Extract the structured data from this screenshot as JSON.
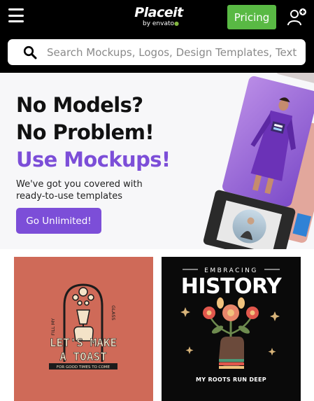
{
  "header": {
    "logo_main": "Placeit",
    "logo_sub": "by envato",
    "pricing_label": "Pricing",
    "icons": {
      "menu": "hamburger-menu-icon",
      "account": "user-add-icon"
    },
    "colors": {
      "background": "#000000",
      "pricing": "#59b944"
    }
  },
  "search": {
    "placeholder": "Search Mockups, Logos, Design Templates, Text",
    "value": "",
    "icon": "search-icon"
  },
  "hero": {
    "line1": "No Models?",
    "line2": "No Problem!",
    "line3": "Use Mockups!",
    "subtitle": "We've got you covered with ready-to-use templates",
    "cta_label": "Go Unlimited!",
    "colors": {
      "accent": "#7c4ed8",
      "background": "#f7f7f9"
    }
  },
  "products": [
    {
      "name": "lets-make-a-toast-design",
      "side_left": "FILL MY",
      "side_right": "GLASS",
      "line1": "LET'S MAKE",
      "line2": "A TOAST",
      "tagline": "FOR GOOD TIMES TO COME",
      "colors": {
        "background": "#cf6a58",
        "accent": "#f4e3c8"
      }
    },
    {
      "name": "embracing-history-design",
      "top": "EMBRACING",
      "main": "HISTORY",
      "bottom": "MY ROOTS RUN DEEP",
      "colors": {
        "background": "#0a0a0a",
        "accent": "#ffffff"
      }
    }
  ]
}
